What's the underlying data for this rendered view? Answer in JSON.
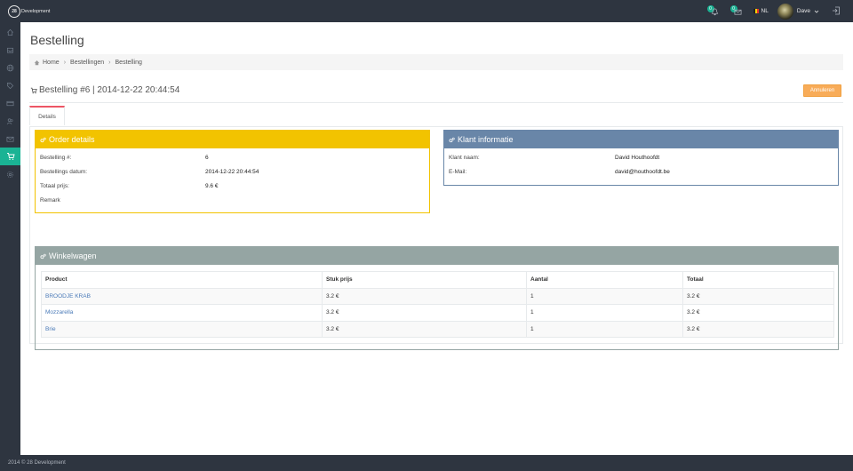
{
  "brand": {
    "logo_mark": "28",
    "logo_text": "Development"
  },
  "topbar": {
    "notifications": [
      {
        "icon": "bell-icon",
        "count": "0"
      },
      {
        "icon": "envelope-icon",
        "count": "0"
      }
    ],
    "language": "NL",
    "user_name": "Dave",
    "colors": {
      "bar": "#2e3540",
      "badge": "#1ab394"
    }
  },
  "sidebar": {
    "items": [
      {
        "icon": "home-icon"
      },
      {
        "icon": "inbox-icon"
      },
      {
        "icon": "globe-icon"
      },
      {
        "icon": "tag-icon"
      },
      {
        "icon": "credit-card-icon"
      },
      {
        "icon": "users-icon"
      },
      {
        "icon": "mail-icon"
      },
      {
        "icon": "cart-icon",
        "active": true
      },
      {
        "icon": "settings-icon"
      }
    ]
  },
  "page": {
    "title": "Bestelling",
    "breadcrumb": [
      "Home",
      "Bestellingen",
      "Bestelling"
    ],
    "order_heading": "Bestelling #6 | 2014-12-22 20:44:54",
    "cancel_label": "Annuleren",
    "tab_label": "Details"
  },
  "order_details": {
    "title": "Order details",
    "color": "#f2c300",
    "rows": [
      {
        "label": "Bestelling #:",
        "value": "6"
      },
      {
        "label": "Bestellings datum:",
        "value": "2014-12-22 20:44:54"
      },
      {
        "label": "Totaal prijs:",
        "value": "9.6 €"
      },
      {
        "label": "Remark",
        "value": ""
      }
    ]
  },
  "client_info": {
    "title": "Klant informatie",
    "color": "#6986a8",
    "rows": [
      {
        "label": "Klant naam:",
        "value": "David Houthoofdt"
      },
      {
        "label": "E-Mail:",
        "value": "david@houthoofdt.be"
      }
    ]
  },
  "cart": {
    "title": "Winkelwagen",
    "color": "#95a5a3",
    "columns": [
      "Product",
      "Stuk prijs",
      "Aantal",
      "Totaal"
    ],
    "rows": [
      [
        "BROODJE KRAB",
        "3.2 €",
        "1",
        "3.2 €"
      ],
      [
        "Mozzarella",
        "3.2 €",
        "1",
        "3.2 €"
      ],
      [
        "Brie",
        "3.2 €",
        "1",
        "3.2 €"
      ]
    ]
  },
  "footer": {
    "text": "2014 © 28 Development"
  }
}
